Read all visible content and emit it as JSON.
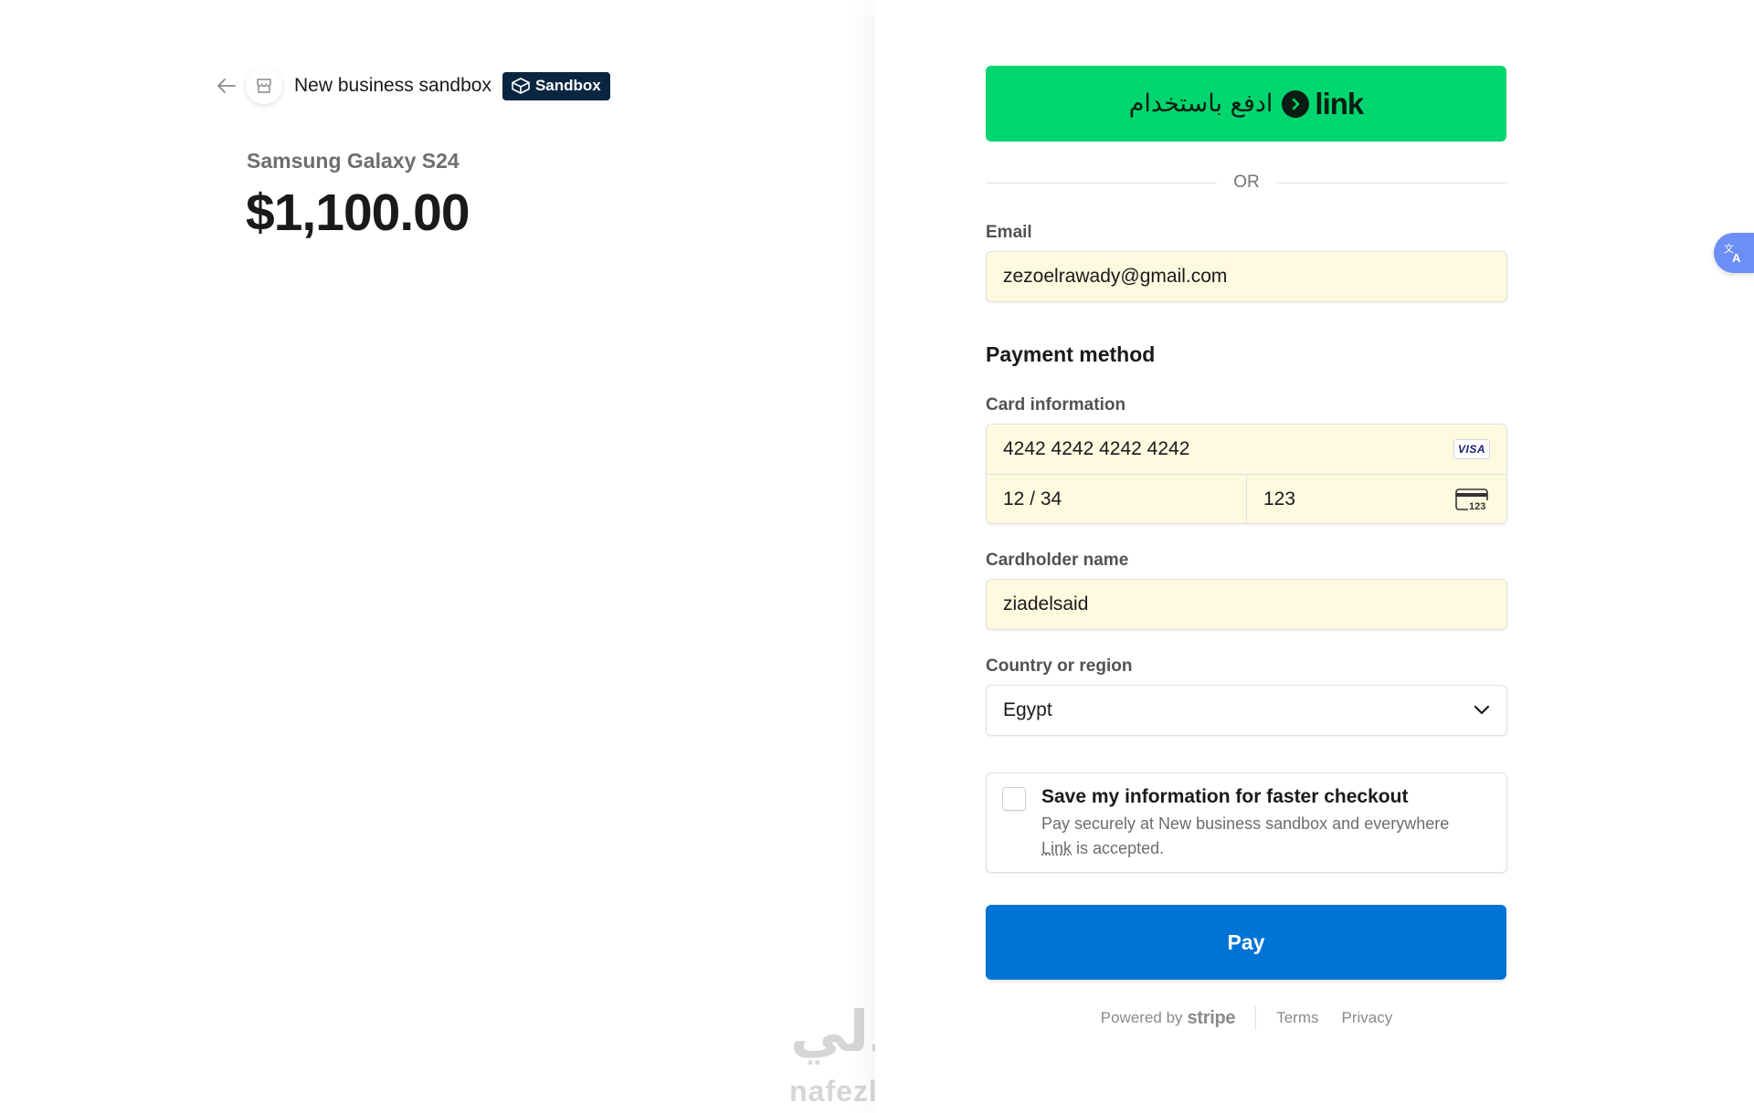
{
  "header": {
    "merchant_name": "New business sandbox",
    "sandbox_label": "Sandbox"
  },
  "product": {
    "name": "Samsung Galaxy S24",
    "price": "$1,100.00"
  },
  "link_button": {
    "arabic_label": "ادفع باستخدام",
    "brand": "link"
  },
  "divider_text": "OR",
  "email": {
    "label": "Email",
    "value": "zezoelrawady@gmail.com"
  },
  "payment": {
    "title": "Payment method",
    "card_label": "Card information",
    "card_number": "4242 4242 4242 4242",
    "card_brand": "VISA",
    "expiry": "12 / 34",
    "cvc": "123",
    "cvc_icon_text": "123"
  },
  "cardholder": {
    "label": "Cardholder name",
    "value": "ziadelsaid"
  },
  "country": {
    "label": "Country or region",
    "value": "Egypt"
  },
  "save_info": {
    "title": "Save my information for faster checkout",
    "desc_prefix": "Pay securely at New business sandbox and everywhere",
    "desc_link": "Link",
    "desc_suffix": "is accepted."
  },
  "pay_button": "Pay",
  "footer": {
    "powered_by": "Powered by",
    "stripe": "stripe",
    "terms": "Terms",
    "privacy": "Privacy"
  },
  "watermark": {
    "arabic": "نفذلي",
    "latin": "nafezly.com"
  },
  "colors": {
    "link_green": "#00d66f",
    "pay_blue": "#0074d4",
    "sandbox_navy": "#0a2540",
    "autofill_yellow": "#fefae0"
  }
}
